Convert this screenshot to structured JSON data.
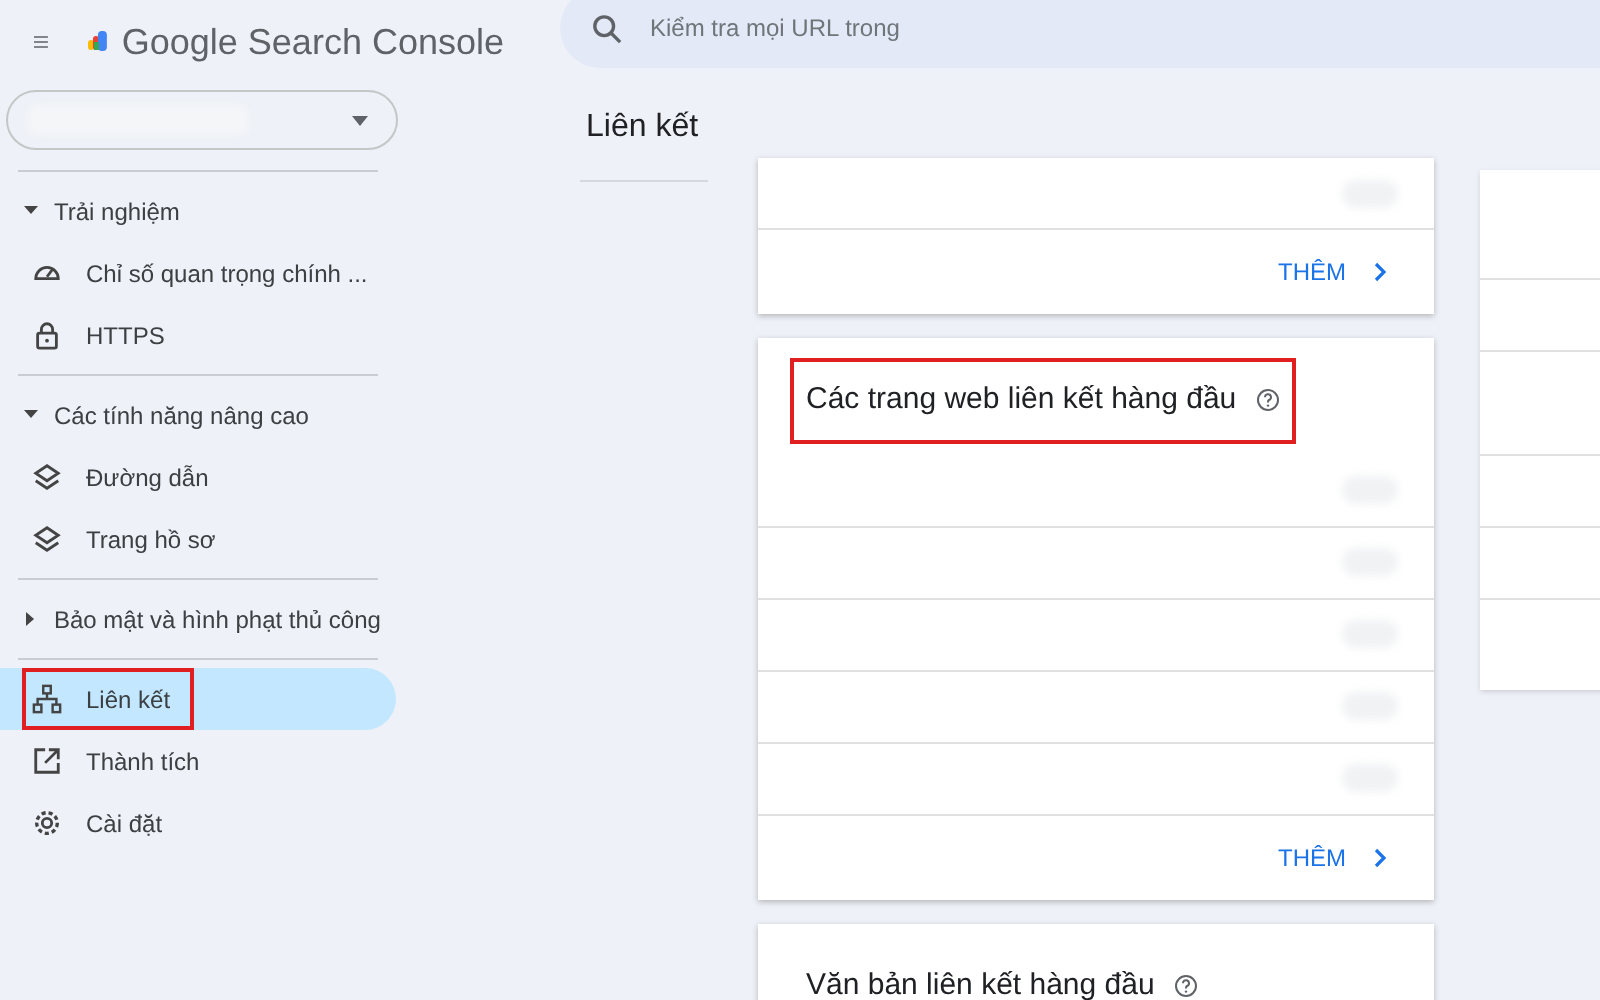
{
  "header": {
    "product": "Google Search Console",
    "search": {
      "placeholder": "Kiểm tra mọi URL trong"
    }
  },
  "sidebar": {
    "groups": [
      {
        "kind": "section",
        "label": "Trải nghiệm",
        "expanded": true,
        "items": [
          {
            "kind": "gauge",
            "label": "Chỉ số quan trọng chính ...",
            "selected": false,
            "highlighted": false
          },
          {
            "kind": "lock",
            "label": "HTTPS",
            "selected": false,
            "highlighted": false
          }
        ]
      },
      {
        "kind": "section",
        "label": "Các tính năng nâng cao",
        "expanded": true,
        "items": [
          {
            "kind": "layers",
            "label": "Đường dẫn",
            "selected": false,
            "highlighted": false
          },
          {
            "kind": "layers",
            "label": "Trang hồ sơ",
            "selected": false,
            "highlighted": false
          }
        ]
      },
      {
        "kind": "section",
        "label": "Bảo mật và hình phạt thủ công",
        "expanded": false
      },
      {
        "kind": "plain",
        "items": [
          {
            "kind": "links",
            "label": "Liên kết",
            "selected": true,
            "highlighted": true
          },
          {
            "kind": "external",
            "label": "Thành tích",
            "selected": false,
            "highlighted": false
          },
          {
            "kind": "gear",
            "label": "Cài đặt",
            "selected": false,
            "highlighted": false
          }
        ]
      }
    ]
  },
  "page_title": "Liên kết",
  "cards": [
    {
      "more": "THÊM"
    },
    {
      "title": "Các trang web liên kết hàng đầu",
      "highlighted": true,
      "more": "THÊM"
    },
    {
      "title": "Văn bản liên kết hàng đầu",
      "highlighted": false
    }
  ]
}
